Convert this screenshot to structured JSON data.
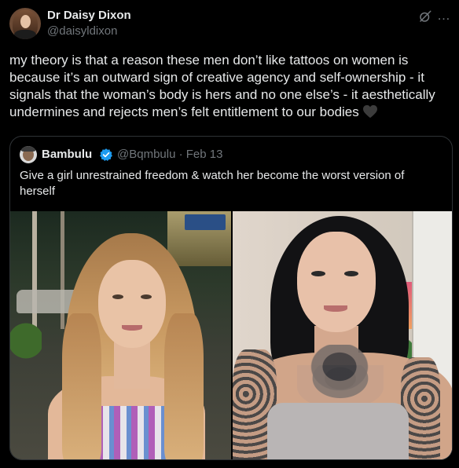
{
  "author": {
    "name": "Dr Daisy Dixon",
    "handle": "@daisyldixon"
  },
  "header_icons": {
    "grok": "grok-icon",
    "more": "…"
  },
  "tweet": {
    "text": "my theory is that a reason these men don’t like tattoos on women is because it’s an outward sign of creative agency and self-ownership - it signals that the woman’s body is hers and no one else’s - it aesthetically undermines and rejects men’s felt entitlement to our bodies",
    "emoji": "black-heart-icon"
  },
  "quote": {
    "name": "Bambulu",
    "verified": "verified-badge-icon",
    "handle_date": "@Bqmbulu · Feb 13",
    "text": "Give a girl unrestrained freedom & watch her become the worst version of herself",
    "images": [
      "photo-woman-no-tattoos",
      "photo-woman-with-tattoos"
    ]
  },
  "colors": {
    "background": "#000000",
    "text": "#e7e9ea",
    "muted": "#71767b",
    "border": "#2f3336",
    "verified": "#1d9bf0"
  }
}
